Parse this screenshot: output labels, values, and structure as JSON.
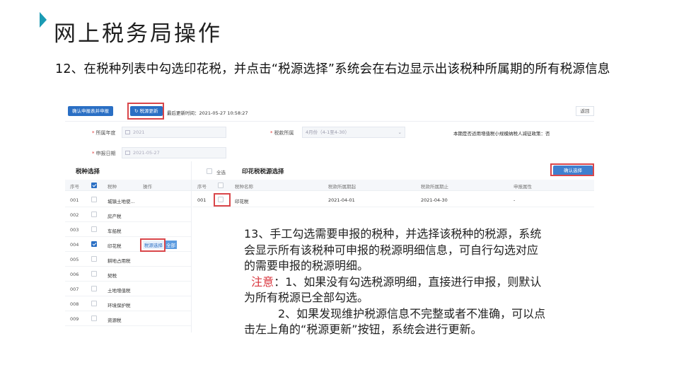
{
  "slide": {
    "title": "网上税务局操作",
    "step12": "12、在税种列表中勾选印花税，并点击“税源选择”系统会在右边显示出该税种所属期的所有税源信息"
  },
  "toolbar": {
    "confirm_declare_label": "确认申报表并申报",
    "update_source_label": "税源更新",
    "last_update": "最后更新时间：2021-05-27 10:58:27",
    "return_label": "返回"
  },
  "form": {
    "year_label": "所属年度",
    "year_value": "2021",
    "period_label": "税款所属",
    "period_value": "4月份（4-1至4-30）",
    "date_label": "申报日期",
    "date_value": "2021-05-27",
    "notice": "本期是否适用增值税小规模纳税人减征政策：否"
  },
  "tax_select": {
    "title": "税种选择",
    "headers": [
      "序号",
      "税种",
      "操作"
    ],
    "op_source": "税源选择",
    "op_all": "全部",
    "rows": [
      {
        "no": "001",
        "name": "城镇土地使...",
        "checked": false
      },
      {
        "no": "002",
        "name": "房产税",
        "checked": false
      },
      {
        "no": "003",
        "name": "车船税",
        "checked": false
      },
      {
        "no": "004",
        "name": "印花税",
        "checked": true
      },
      {
        "no": "005",
        "name": "耕地占用税",
        "checked": false
      },
      {
        "no": "006",
        "name": "契税",
        "checked": false
      },
      {
        "no": "007",
        "name": "土地增值税",
        "checked": false
      },
      {
        "no": "008",
        "name": "环境保护税",
        "checked": false
      },
      {
        "no": "009",
        "name": "资源税",
        "checked": false
      }
    ]
  },
  "source_select": {
    "select_all": "全选",
    "title": "印花税税源选择",
    "confirm_label": "确认选择",
    "headers": [
      "序号",
      "税种名称",
      "税款所属期起",
      "税款所属期止",
      "申报属性"
    ],
    "row": {
      "no": "001",
      "name": "印花税",
      "start": "2021-04-01",
      "end": "2021-04-30",
      "attr": "-"
    }
  },
  "notes": {
    "line1": "13、手工勾选需要申报的税种，并选择该税种的税源，系统",
    "line2": "会显示所有该税种可申报的税源明细信息，可自行勾选对应",
    "line3": "的需要申报的税源明细。",
    "warn_label": "注意",
    "line4": "：1、如果没有勾选税源明细，直接进行申报，则默认",
    "line5": "为所有税源已全部勾选。",
    "line6": "2、如果发现维护税源信息不完整或者不准确，可以点",
    "line7": "击左上角的“税源更新”按钮，系统会进行更新。"
  },
  "colors": {
    "accent": "#1b9bb4",
    "highlight": "#d9464a",
    "primary": "#2a6fc4",
    "warning": "#d9363e"
  }
}
